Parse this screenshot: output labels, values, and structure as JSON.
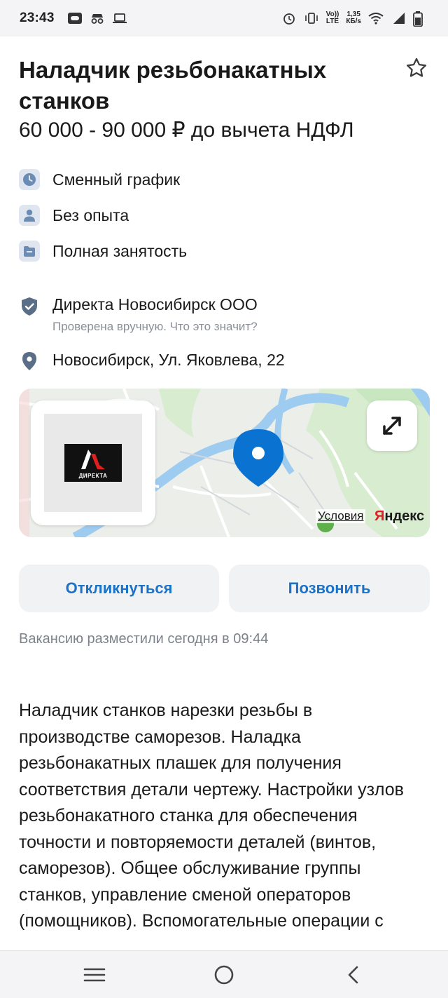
{
  "status_bar": {
    "time": "23:43",
    "speed_value": "1,35",
    "speed_unit": "КБ/s",
    "network_type": "LTE",
    "volte": "Vo))"
  },
  "vacancy": {
    "title": "Наладчик резьбонакатных станков",
    "salary": "60 000 - 90 000 ₽ до вычета НДФЛ",
    "features": [
      {
        "icon": "clock-icon",
        "label": "Сменный график"
      },
      {
        "icon": "person-icon",
        "label": "Без опыта"
      },
      {
        "icon": "folder-icon",
        "label": "Полная занятость"
      }
    ],
    "company": {
      "name": "Директа Новосибирск ООО",
      "verified_text": "Проверена вручную. Что это значит?"
    },
    "address": "Новосибирск, Ул. Яковлева, 22",
    "map": {
      "terms_label": "Условия",
      "brand_prefix": "Я",
      "brand_rest": "ндекс",
      "logo_text": "ДИРЕКТА"
    },
    "buttons": {
      "respond": "Откликнуться",
      "call": "Позвонить"
    },
    "posted": "Вакансию разместили сегодня в 09:44",
    "description": "Наладчик станков нарезки резьбы в производстве саморезов. Наладка резьбонакатных плашек для получения соответствия детали чертежу. Настройки узлов резьбонакатного станка для обеспечения точности и повторяемости деталей (винтов, саморезов). Общее обслуживание группы станков, управление сменой операторов (помощников). Вспомогательные операции с"
  },
  "colors": {
    "accent": "#1a73c8",
    "map_pin": "#0a73d1",
    "feature_icon_bg": "#dfe6f0",
    "feature_icon_fg": "#6b8cb5",
    "company_icon": "#5a6f87",
    "muted_text": "#7d828a"
  }
}
